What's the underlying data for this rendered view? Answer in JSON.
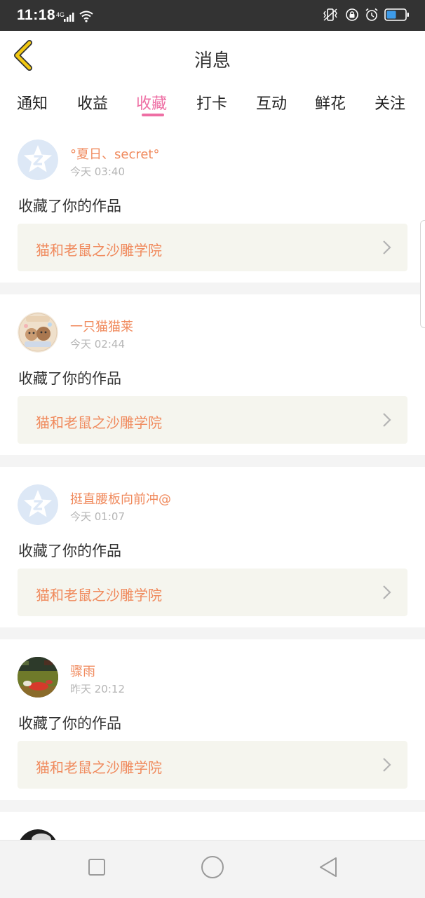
{
  "status_bar": {
    "time": "11:18",
    "network": "4G",
    "icons": [
      "signal-icon",
      "wifi-icon",
      "vibrate-icon",
      "lock-rotation-icon",
      "alarm-icon",
      "battery-icon"
    ]
  },
  "header": {
    "title": "消息",
    "back_icon": "chevron-left-icon"
  },
  "tabs": [
    {
      "label": "通知",
      "active": false
    },
    {
      "label": "收益",
      "active": false
    },
    {
      "label": "收藏",
      "active": true
    },
    {
      "label": "打卡",
      "active": false
    },
    {
      "label": "互动",
      "active": false
    },
    {
      "label": "鲜花",
      "active": false
    },
    {
      "label": "关注",
      "active": false
    }
  ],
  "colors": {
    "accent_pink": "#ee6fa4",
    "name_orange": "#f08a5d",
    "back_yellow": "#f2c811",
    "card_bg": "#f5f5ee"
  },
  "messages": [
    {
      "user": "°夏日、secret°",
      "time": "今天 03:40",
      "avatar": "default-avatar",
      "action": "收藏了你的作品",
      "work": "猫和老鼠之沙雕学院"
    },
    {
      "user": "一只猫猫莱",
      "time": "今天 02:44",
      "avatar": "photo-avatar",
      "action": "收藏了你的作品",
      "work": "猫和老鼠之沙雕学院"
    },
    {
      "user": "挺直腰板向前冲@",
      "time": "今天 01:07",
      "avatar": "default-avatar",
      "action": "收藏了你的作品",
      "work": "猫和老鼠之沙雕学院"
    },
    {
      "user": "骤雨",
      "time": "昨天 20:12",
      "avatar": "photo-avatar",
      "action": "收藏了你的作品",
      "work": "猫和老鼠之沙雕学院"
    }
  ],
  "nav_bar": {
    "buttons": [
      "recent-apps-button",
      "home-button",
      "back-button"
    ]
  }
}
